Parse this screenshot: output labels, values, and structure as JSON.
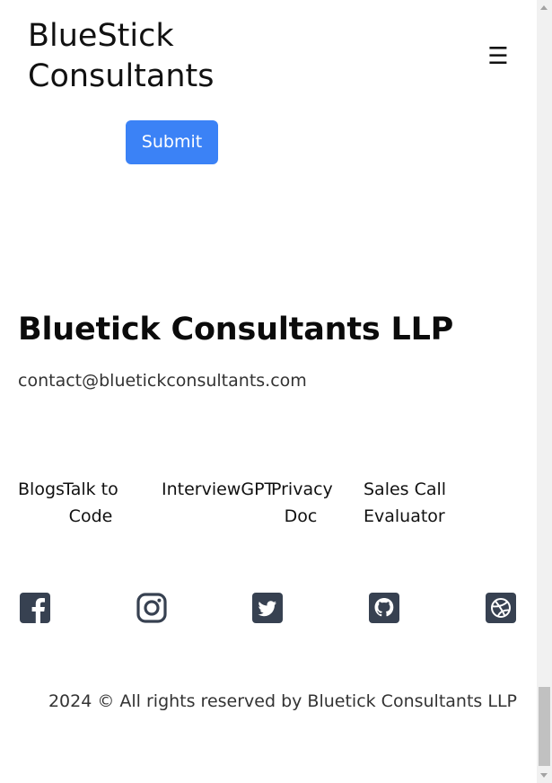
{
  "header": {
    "brand_line1": "BlueStick",
    "brand_line2": "Consultants",
    "menu_glyph": "☰",
    "menu_icon": "hamburger-menu-icon"
  },
  "form": {
    "submit_label": "Submit",
    "accent_color": "#3b82f6"
  },
  "footer": {
    "company": "Bluetick Consultants LLP",
    "email": "contact@bluetickconsultants.com",
    "links": {
      "blogs": "Blogs",
      "talk_line1": "Talk to",
      "talk_line2": "Code",
      "interview": "InterviewGPT",
      "privacy_line1": "Privacy",
      "privacy_line2": "Doc",
      "sales_line1": "Sales Call",
      "sales_line2": "Evaluator"
    },
    "social_icons": [
      "facebook-icon",
      "instagram-icon",
      "twitter-icon",
      "github-icon",
      "dribbble-icon"
    ],
    "social_icon_color": "#374151",
    "copyright": "2024 © All rights reserved by Bluetick Consultants LLP"
  }
}
